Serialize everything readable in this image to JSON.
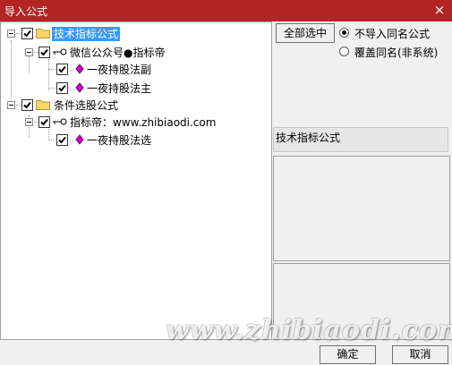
{
  "window": {
    "title": "导入公式",
    "close_glyph": "×"
  },
  "tree": {
    "root1": {
      "label": "技术指标公式",
      "checked": true
    },
    "author1": {
      "label": "微信公众号●指标帝",
      "checked": true
    },
    "f1": {
      "label": "一夜持股法副",
      "checked": true
    },
    "f2": {
      "label": "一夜持股法主",
      "checked": true
    },
    "root2": {
      "label": "条件选股公式",
      "checked": true
    },
    "author2": {
      "label": "指标帝：www.zhibiaodi.com",
      "checked": true
    },
    "f3": {
      "label": "一夜持股法选",
      "checked": true
    }
  },
  "options": {
    "select_all": "全部选中",
    "radio1": "不导入同名公式",
    "radio2": "覆盖同名(非系统)",
    "selected_radio": "radio1"
  },
  "info": {
    "category": "技术指标公式"
  },
  "footer": {
    "ok": "确定",
    "cancel": "取消"
  },
  "watermark": "www.zhibiaodi.com",
  "colors": {
    "title_bar": "#b32424",
    "selection": "#3399ff",
    "formula_icon": "#cc00cc",
    "folder": "#f5d76e"
  }
}
